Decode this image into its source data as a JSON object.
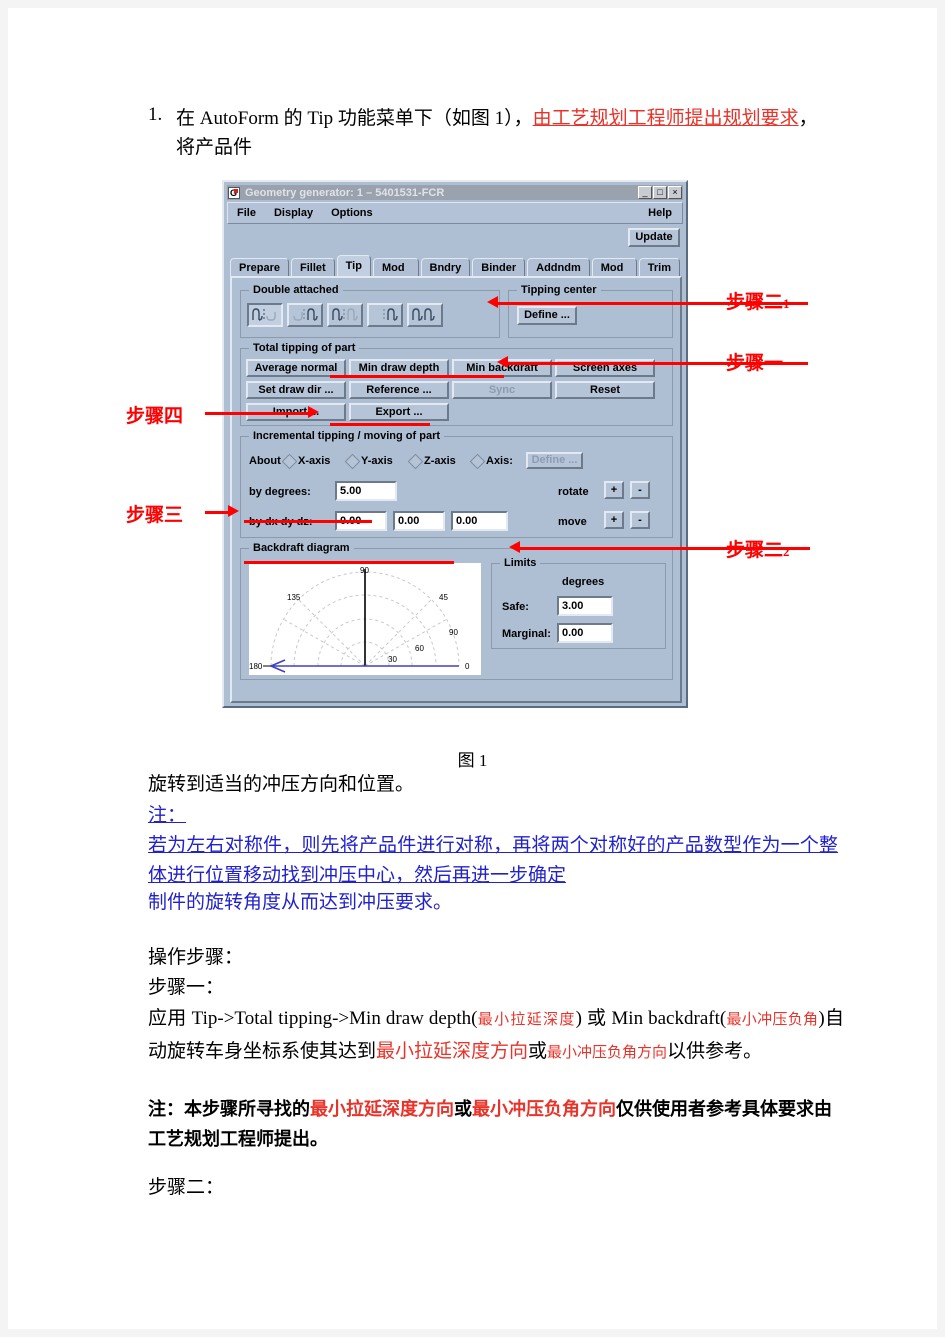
{
  "document": {
    "list_number": "1.",
    "para1_a": "在 AutoForm 的 Tip 功能菜单下（如图 1），",
    "para1_underline": "由工艺规划工程师提出规划要求",
    "para1_b": "，将产品件",
    "figure_caption": "图 1",
    "para2": "旋转到适当的冲压方向和位置。",
    "note_label": "注：",
    "note_body": "若为左右对称件，则先将产品件进行对称，再将两个对称好的产品数型作为一个整体进行位置移动找到冲压中心，然后再进一步确定",
    "note_tail": "制件的旋转角度从而达到冲压要求。",
    "ops_label": "操作步骤：",
    "step1_label": "步骤一：",
    "step1_a": "应用 Tip->Total  tipping->Min  draw  depth(",
    "step1_red1": "最小拉延深度",
    "step1_b": ") 或 Min backdraft(",
    "step1_red2": "最小冲压负角",
    "step1_c": ")自动旋转车身坐标系使其达到",
    "step1_red3": "最小拉延深度方向",
    "step1_d": "或",
    "step1_red4": "最小冲压负角方向",
    "step1_e": "以供参考。",
    "note2_a": "注：本步骤所寻找的",
    "note2_red1": "最小拉延深度方向",
    "note2_b": "或",
    "note2_red2": "最小冲压负角方向",
    "note2_c": "仅供使用者参考具体要求由工艺规划工程师提出。",
    "step2_label": "步骤二："
  },
  "annotations": {
    "step_two_1": "步骤二",
    "step_two_1_sub": "1",
    "step_one": "步骤一",
    "step_four": "步骤四",
    "step_three": "步骤三",
    "step_two_2": "步骤二",
    "step_two_2_sub": "2",
    "color": "#ff0000"
  },
  "app": {
    "title": "Geometry generator: 1 – 5401531-FCR",
    "window_buttons": [
      "_",
      "□",
      "×"
    ],
    "menus": [
      "File",
      "Display",
      "Options"
    ],
    "help_menu": "Help",
    "update_button": "Update",
    "tabs": [
      {
        "label": "Prepare",
        "selected": false
      },
      {
        "label": "Fillet",
        "selected": false
      },
      {
        "label": "Tip",
        "selected": true
      },
      {
        "label": "Mod P",
        "selected": false
      },
      {
        "label": "Bndry",
        "selected": false
      },
      {
        "label": "Binder",
        "selected": false
      },
      {
        "label": "Addndm",
        "selected": false
      },
      {
        "label": "Mod T",
        "selected": false
      },
      {
        "label": "Trim",
        "selected": false
      }
    ],
    "double_attached": {
      "title": "Double attached",
      "icons": [
        "double-attached-left-active-icon",
        "double-attached-right-active-icon",
        "double-attached-both-left-icon",
        "double-attached-both-right-icon",
        "double-attached-merged-icon"
      ],
      "selected_index": 0
    },
    "tipping_center": {
      "title": "Tipping center",
      "define_button": "Define ..."
    },
    "total_tipping": {
      "title": "Total tipping of part",
      "row1": [
        "Average normal",
        "Min draw depth",
        "Min backdraft",
        "Screen axes"
      ],
      "row2": [
        "Set draw dir ...",
        "Reference ...",
        "Sync",
        "Reset"
      ],
      "row2_disabled": [
        "Sync"
      ],
      "row3": [
        "Import ...",
        "Export ..."
      ]
    },
    "incremental": {
      "title": "Incremental tipping / moving of part",
      "about_label": "About",
      "axes": [
        "X-axis",
        "Y-axis",
        "Z-axis",
        "Axis:"
      ],
      "axis_define_button": "Define ...",
      "by_degrees_label": "by degrees:",
      "by_degrees_value": "5.00",
      "rotate_label": "rotate",
      "rotate_plus": "+",
      "rotate_minus": "-",
      "by_dxdydz_label": "by dx dy dz:",
      "dx_value": "0.00",
      "dy_value": "0.00",
      "dz_value": "0.00",
      "move_label": "move",
      "move_plus": "+",
      "move_minus": "-"
    },
    "backdraft": {
      "title": "Backdraft diagram",
      "polar_labels": [
        "90",
        "135",
        "45",
        "90",
        "60",
        "30",
        "180",
        "0"
      ],
      "limits": {
        "title": "Limits",
        "degrees_header": "degrees",
        "safe_label": "Safe:",
        "safe_value": "3.00",
        "marginal_label": "Marginal:",
        "marginal_value": "0.00"
      }
    }
  }
}
